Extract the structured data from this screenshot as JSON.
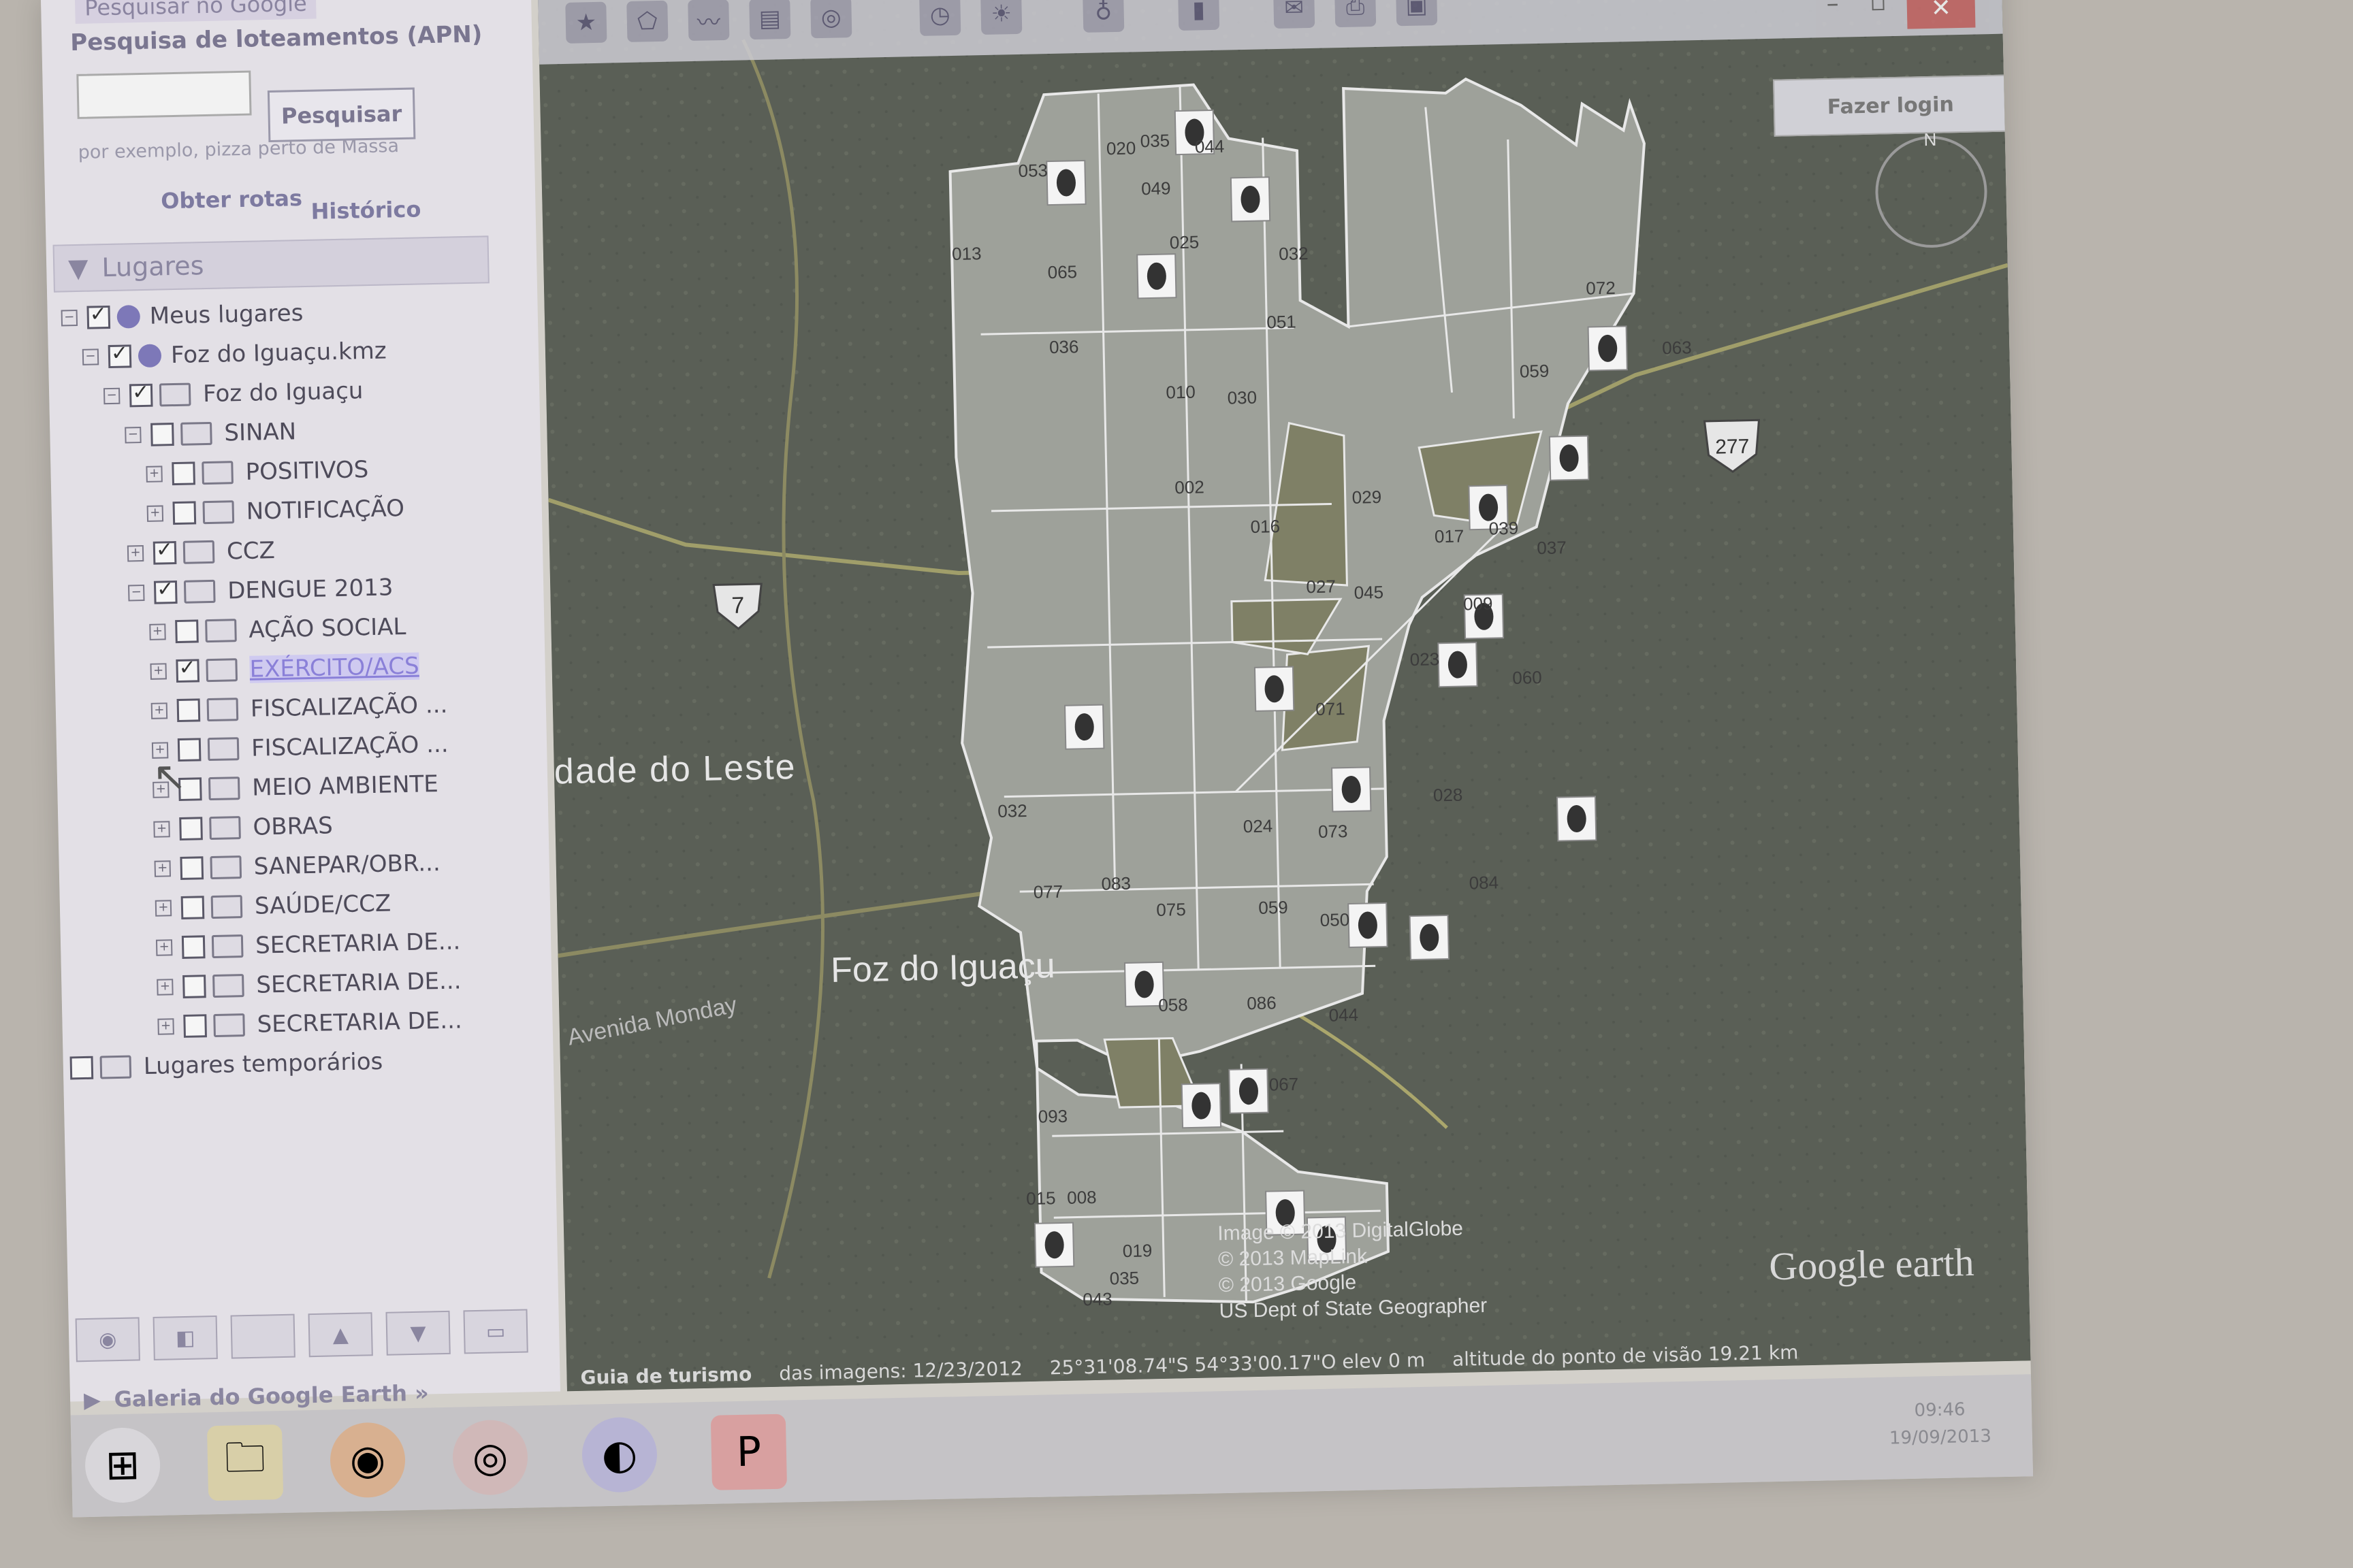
{
  "search": {
    "tab_label": "Pesquisar no Google",
    "title": "Pesquisa de loteamentos (APN)",
    "button_label": "Pesquisar",
    "hint": "por exemplo, pizza perto de Massa",
    "route_link": "Obter rotas",
    "history_link": "Histórico"
  },
  "places": {
    "header": "Lugares",
    "tree": [
      {
        "label": "Meus lugares",
        "checked": true,
        "icon": "globe-icon"
      },
      {
        "label": "Foz do Iguaçu.kmz",
        "checked": true,
        "icon": "globe-icon"
      },
      {
        "label": "Foz do Iguaçu",
        "checked": true,
        "icon": "folder-icon"
      },
      {
        "label": "SINAN",
        "checked": false,
        "icon": "folder-icon"
      },
      {
        "label": "POSITIVOS",
        "checked": false,
        "icon": "folder-icon"
      },
      {
        "label": "NOTIFICAÇÃO",
        "checked": false,
        "icon": "folder-icon"
      },
      {
        "label": "CCZ",
        "checked": true,
        "icon": "folder-icon"
      },
      {
        "label": "DENGUE 2013",
        "checked": true,
        "icon": "folder-icon"
      },
      {
        "label": "AÇÃO SOCIAL",
        "checked": false,
        "icon": "folder-icon"
      },
      {
        "label": "EXÉRCITO/ACS",
        "checked": true,
        "icon": "folder-icon",
        "selected": true
      },
      {
        "label": "FISCALIZAÇÃO ...",
        "checked": false,
        "icon": "folder-icon"
      },
      {
        "label": "FISCALIZAÇÃO ...",
        "checked": false,
        "icon": "folder-icon"
      },
      {
        "label": "MEIO AMBIENTE",
        "checked": false,
        "icon": "folder-icon"
      },
      {
        "label": "OBRAS",
        "checked": false,
        "icon": "folder-icon"
      },
      {
        "label": "SANEPAR/OBR...",
        "checked": false,
        "icon": "folder-icon"
      },
      {
        "label": "SAÚDE/CCZ",
        "checked": false,
        "icon": "folder-icon"
      },
      {
        "label": "SECRETARIA DE...",
        "checked": false,
        "icon": "folder-icon"
      },
      {
        "label": "SECRETARIA DE...",
        "checked": false,
        "icon": "folder-icon"
      },
      {
        "label": "SECRETARIA DE...",
        "checked": false,
        "icon": "folder-icon"
      },
      {
        "label": "Lugares temporários",
        "checked": false,
        "icon": "folder-icon"
      }
    ]
  },
  "gallery_label": "Galeria do Google Earth »",
  "login_label": "Fazer login",
  "map": {
    "place_labels": [
      "dade do Leste",
      "Foz do Iguaçu",
      "Avenida Monday"
    ],
    "road_shield": "7",
    "road_shield_2": "277",
    "attribution": [
      "Image © 2013 DigitalGlobe",
      "© 2013 MapLink",
      "© 2013 Google",
      "US Dept of State Geographer"
    ],
    "logo": "Google earth",
    "zone_labels": [
      "053",
      "020",
      "035",
      "044",
      "049",
      "025",
      "032",
      "013",
      "065",
      "051",
      "036",
      "010",
      "030",
      "072",
      "059",
      "063",
      "002",
      "016",
      "029",
      "017",
      "039",
      "027",
      "045",
      "037",
      "009",
      "023",
      "060",
      "071",
      "032",
      "024",
      "073",
      "028",
      "077",
      "083",
      "075",
      "059",
      "050",
      "084",
      "058",
      "086",
      "044",
      "067",
      "093",
      "008",
      "015",
      "043",
      "035",
      "019"
    ]
  },
  "statusbar": {
    "tour_guide": "Guia de turismo",
    "imagery_date": "das imagens: 12/23/2012",
    "coords": "25°31'08.74\"S  54°33'00.17\"O  elev   0 m",
    "eye_alt": "altitude do ponto de visão  19.21 km"
  },
  "clock": {
    "time": "09:46",
    "date": "19/09/2013"
  }
}
